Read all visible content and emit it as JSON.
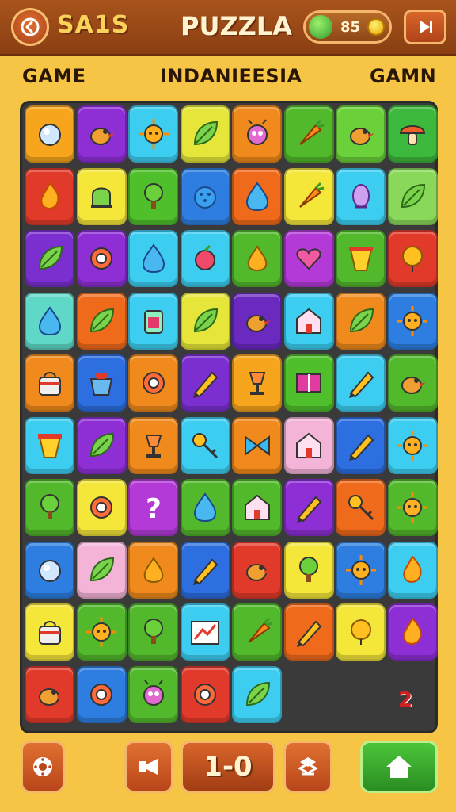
{
  "header": {
    "title_left": "SA1S",
    "title_center": "PUZZLA",
    "currency_count": "85",
    "back_icon": "back-arrow-icon",
    "play_icon": "play-icon"
  },
  "labels": {
    "left": "GAME",
    "center": "INDANIEESIA",
    "right": "GAMN"
  },
  "board": {
    "badge": "2",
    "rows": [
      [
        {
          "c": "#f7a51c",
          "i": "orb"
        },
        {
          "c": "#8e2fd6",
          "i": "bird"
        },
        {
          "c": "#3ccdf0",
          "i": "sun"
        },
        {
          "c": "#e6e63a",
          "i": "leaf"
        },
        {
          "c": "#f08a1c",
          "i": "bug"
        },
        {
          "c": "#52b82c",
          "i": "carrot"
        },
        {
          "c": "#6ad13a",
          "i": "bird"
        },
        {
          "c": "#3cb83c",
          "i": "mushroom"
        }
      ],
      [
        {
          "c": "#e23a2a",
          "i": "flame"
        },
        {
          "c": "#f5e63a",
          "i": "bell"
        },
        {
          "c": "#4fbf2c",
          "i": "tree"
        },
        {
          "c": "#2d7ee0",
          "i": "berry"
        },
        {
          "c": "#f06a1c",
          "i": "drop"
        },
        {
          "c": "#f5e63a",
          "i": "carrot"
        },
        {
          "c": "#3ccdf0",
          "i": "shell"
        },
        {
          "c": "#8ad85a",
          "i": "leaf"
        }
      ],
      [
        {
          "c": "#7b2fd0",
          "i": "leaf"
        },
        {
          "c": "#8e2fd6",
          "i": "ring"
        },
        {
          "c": "#3ccdf0",
          "i": "drop"
        },
        {
          "c": "#3ccdf0",
          "i": "fruit"
        },
        {
          "c": "#52b82c",
          "i": "pear"
        },
        {
          "c": "#b43ad8",
          "i": "heart"
        },
        {
          "c": "#52b82c",
          "i": "cup"
        },
        {
          "c": "#e23a2a",
          "i": "balloon"
        }
      ],
      [
        {
          "c": "#5fd8c8",
          "i": "drop"
        },
        {
          "c": "#f06a1c",
          "i": "leaf"
        },
        {
          "c": "#3ccdf0",
          "i": "jar"
        },
        {
          "c": "#e6e63a",
          "i": "leaf"
        },
        {
          "c": "#6a2ac0",
          "i": "bird"
        },
        {
          "c": "#3ccdf0",
          "i": "house"
        },
        {
          "c": "#f08a1c",
          "i": "leaf"
        },
        {
          "c": "#2d7ee0",
          "i": "sun"
        }
      ],
      [
        {
          "c": "#f08a1c",
          "i": "bag"
        },
        {
          "c": "#2d6ee0",
          "i": "pot"
        },
        {
          "c": "#f08a1c",
          "i": "ring"
        },
        {
          "c": "#7b2fd0",
          "i": "pencil"
        },
        {
          "c": "#f7a51c",
          "i": "lamp"
        },
        {
          "c": "#4fbf2c",
          "i": "book"
        },
        {
          "c": "#3ccdf0",
          "i": "pencil"
        },
        {
          "c": "#52b82c",
          "i": "bird"
        }
      ],
      [
        {
          "c": "#3ccdf0",
          "i": "cup"
        },
        {
          "c": "#8e2fd6",
          "i": "leaf"
        },
        {
          "c": "#f08a1c",
          "i": "lamp"
        },
        {
          "c": "#3ccdf0",
          "i": "key"
        },
        {
          "c": "#f08a1c",
          "i": "bow"
        },
        {
          "c": "#f3b4d8",
          "i": "house"
        },
        {
          "c": "#2d6ee0",
          "i": "pencil"
        },
        {
          "c": "#3ccdf0",
          "i": "sun"
        }
      ],
      [
        {
          "c": "#52b82c",
          "i": "tree"
        },
        {
          "c": "#f5e63a",
          "i": "ring"
        },
        {
          "c": "#b43ad8",
          "i": "question"
        },
        {
          "c": "#52b82c",
          "i": "drop"
        },
        {
          "c": "#52b82c",
          "i": "house"
        },
        {
          "c": "#8e2fd6",
          "i": "pencil"
        },
        {
          "c": "#f06a1c",
          "i": "key"
        },
        {
          "c": "#52b82c",
          "i": "sun"
        }
      ],
      [
        {
          "c": "#2d7ee0",
          "i": "orb"
        },
        {
          "c": "#f3b4d8",
          "i": "leaf"
        },
        {
          "c": "#f08a1c",
          "i": "pear"
        },
        {
          "c": "#2d6ee0",
          "i": "pencil"
        },
        {
          "c": "#e23a2a",
          "i": "bird"
        },
        {
          "c": "#f5e63a",
          "i": "tree"
        },
        {
          "c": "#2d7ee0",
          "i": "sun"
        },
        {
          "c": "#3ccdf0",
          "i": "flame"
        }
      ],
      [
        {
          "c": "#f5e63a",
          "i": "bag"
        },
        {
          "c": "#52b82c",
          "i": "sun"
        },
        {
          "c": "#52b82c",
          "i": "tree"
        },
        {
          "c": "#3ccdf0",
          "i": "chart"
        },
        {
          "c": "#52b82c",
          "i": "carrot"
        },
        {
          "c": "#f06a1c",
          "i": "pencil"
        },
        {
          "c": "#f5e63a",
          "i": "balloon"
        },
        {
          "c": "#8e2fd6",
          "i": "flame"
        }
      ],
      [
        {
          "c": "#e23a2a",
          "i": "bird"
        },
        {
          "c": "#2d7ee0",
          "i": "ring"
        },
        {
          "c": "#52b82c",
          "i": "bug"
        },
        {
          "c": "#e23a2a",
          "i": "ring"
        },
        {
          "c": "#3ccdf0",
          "i": "leaf"
        }
      ]
    ]
  },
  "footer": {
    "score": "1-0",
    "settings_icon": "gear-icon",
    "camera_icon": "camera-icon",
    "shuffle_icon": "shuffle-icon",
    "home_icon": "home-icon"
  }
}
